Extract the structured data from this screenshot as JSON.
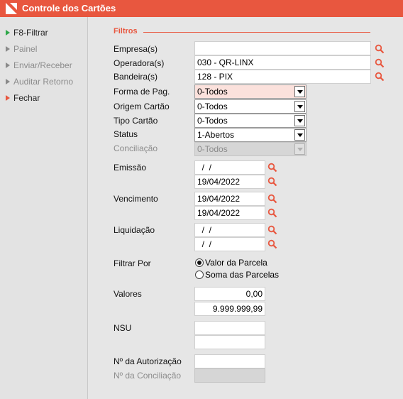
{
  "window": {
    "title": "Controle dos Cartões"
  },
  "colors": {
    "accent": "#e8573f",
    "filter_arrow": "#2fa84a"
  },
  "sidebar": {
    "items": [
      {
        "label": "F8-Filtrar"
      },
      {
        "label": "Painel"
      },
      {
        "label": "Enviar/Receber"
      },
      {
        "label": "Auditar Retorno"
      },
      {
        "label": "Fechar"
      }
    ]
  },
  "filters": {
    "section_title": "Filtros",
    "empresa": {
      "label": "Empresa(s)",
      "value": ""
    },
    "operadora": {
      "label": "Operadora(s)",
      "value": "030 - QR-LINX"
    },
    "bandeira": {
      "label": "Bandeira(s)",
      "value": "128 - PIX"
    },
    "forma_pag": {
      "label": "Forma de Pag.",
      "value": "0-Todos"
    },
    "origem_cartao": {
      "label": "Origem Cartão",
      "value": "0-Todos"
    },
    "tipo_cartao": {
      "label": "Tipo Cartão",
      "value": "0-Todos"
    },
    "status": {
      "label": "Status",
      "value": "1-Abertos"
    },
    "conciliacao": {
      "label": "Conciliação",
      "value": "0-Todos"
    },
    "emissao": {
      "label": "Emissão",
      "from": "  /  /",
      "to": "19/04/2022"
    },
    "vencimento": {
      "label": "Vencimento",
      "from": "19/04/2022",
      "to": "19/04/2022"
    },
    "liquidacao": {
      "label": "Liquidação",
      "from": "  /  /",
      "to": "  /  /"
    },
    "filtrar_por": {
      "label": "Filtrar Por",
      "options": [
        {
          "label": "Valor da Parcela",
          "selected": true
        },
        {
          "label": "Soma das Parcelas",
          "selected": false
        }
      ]
    },
    "valores": {
      "label": "Valores",
      "from": "0,00",
      "to": "9.999.999,99"
    },
    "nsu": {
      "label": "NSU",
      "from": "",
      "to": ""
    },
    "autorizacao": {
      "label": "Nº da Autorização",
      "value": ""
    },
    "num_conciliacao": {
      "label": "Nº da Conciliação",
      "value": ""
    }
  }
}
